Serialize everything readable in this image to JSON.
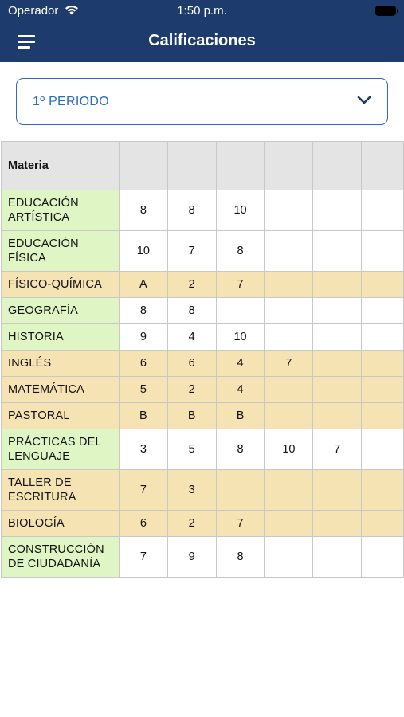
{
  "status": {
    "carrier": "Operador",
    "time": "1:50 p.m."
  },
  "header": {
    "title": "Calificaciones",
    "menu_icon": "hamburger-icon"
  },
  "period": {
    "selected": "1º PERIODO",
    "dropdown_icon": "chevron-down-icon"
  },
  "colors": {
    "navbar": "#1d3b6c",
    "accent": "#2a6bc3",
    "green_row": "#dff5c4",
    "beige_row": "#f6e3b4",
    "header_gray": "#e4e4e4"
  },
  "table": {
    "header": "Materia",
    "rows": [
      {
        "subject": "EDUCACIÓN ARTÍSTICA",
        "grades": [
          "8",
          "8",
          "10",
          "",
          "",
          ""
        ],
        "tall": true,
        "bg": "#dff5c4",
        "gbg": "#ffffff"
      },
      {
        "subject": "EDUCACIÓN FÍSICA",
        "grades": [
          "10",
          "7",
          "8",
          "",
          "",
          ""
        ],
        "tall": true,
        "bg": "#dff5c4",
        "gbg": "#ffffff"
      },
      {
        "subject": "FÍSICO-QUÍMICA",
        "grades": [
          "A",
          "2",
          "7",
          "",
          "",
          ""
        ],
        "tall": false,
        "bg": "#f6e3b4",
        "gbg": "#f6e3b4"
      },
      {
        "subject": "GEOGRAFÍA",
        "grades": [
          "8",
          "8",
          "",
          "",
          "",
          ""
        ],
        "tall": false,
        "bg": "#dff5c4",
        "gbg": "#ffffff"
      },
      {
        "subject": "HISTORIA",
        "grades": [
          "9",
          "4",
          "10",
          "",
          "",
          ""
        ],
        "tall": false,
        "bg": "#dff5c4",
        "gbg": "#ffffff"
      },
      {
        "subject": "INGLÉS",
        "grades": [
          "6",
          "6",
          "4",
          "7",
          "",
          ""
        ],
        "tall": false,
        "bg": "#f6e3b4",
        "gbg": "#f6e3b4"
      },
      {
        "subject": "MATEMÁTICA",
        "grades": [
          "5",
          "2",
          "4",
          "",
          "",
          ""
        ],
        "tall": false,
        "bg": "#f6e3b4",
        "gbg": "#f6e3b4"
      },
      {
        "subject": "PASTORAL",
        "grades": [
          "B",
          "B",
          "B",
          "",
          "",
          ""
        ],
        "tall": false,
        "bg": "#f6e3b4",
        "gbg": "#f6e3b4"
      },
      {
        "subject": "PRÁCTICAS DEL LENGUAJE",
        "grades": [
          "3",
          "5",
          "8",
          "10",
          "7",
          ""
        ],
        "tall": true,
        "bg": "#dff5c4",
        "gbg": "#ffffff"
      },
      {
        "subject": "TALLER DE ESCRITURA",
        "grades": [
          "7",
          "3",
          "",
          "",
          "",
          ""
        ],
        "tall": true,
        "bg": "#f6e3b4",
        "gbg": "#f6e3b4"
      },
      {
        "subject": "BIOLOGÍA",
        "grades": [
          "6",
          "2",
          "7",
          "",
          "",
          ""
        ],
        "tall": false,
        "bg": "#f6e3b4",
        "gbg": "#f6e3b4"
      },
      {
        "subject": "CONSTRUCCIÓN DE CIUDADANÍA",
        "grades": [
          "7",
          "9",
          "8",
          "",
          "",
          ""
        ],
        "tall": true,
        "bg": "#dff5c4",
        "gbg": "#ffffff"
      }
    ]
  }
}
